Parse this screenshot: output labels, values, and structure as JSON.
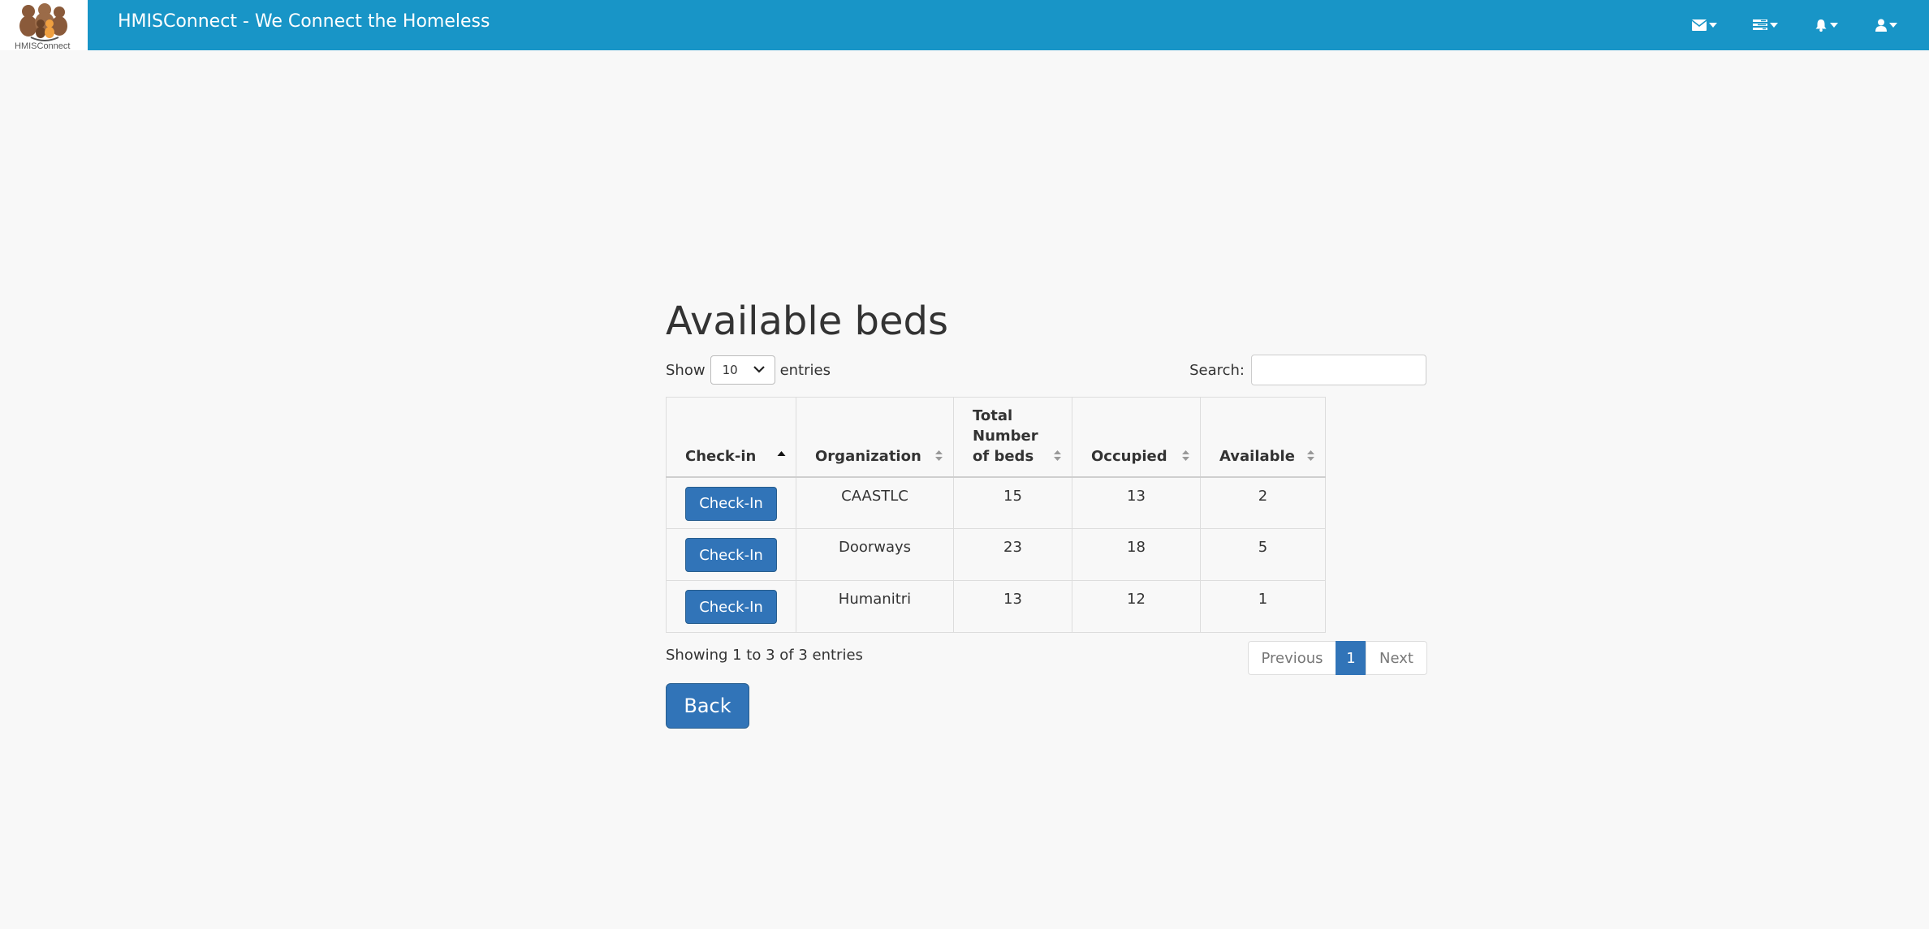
{
  "header": {
    "logo_text": "HMISConnect",
    "title": "HMISConnect - We Connect the Homeless",
    "icons": [
      "envelope-icon",
      "tasks-icon",
      "bell-icon",
      "user-icon"
    ],
    "bar_color": "#1895c7"
  },
  "page": {
    "title": "Available beds"
  },
  "length_menu": {
    "show_label": "Show",
    "selected": "10",
    "entries_label": "entries"
  },
  "search": {
    "label": "Search:",
    "value": ""
  },
  "table": {
    "columns": [
      "Check-in",
      "Organization",
      "Total Number of beds",
      "Occupied",
      "Available"
    ],
    "sorted_column": "Check-in",
    "rows": [
      {
        "action": "Check-In",
        "organization": "CAASTLC",
        "total": "15",
        "occupied": "13",
        "available": "2"
      },
      {
        "action": "Check-In",
        "organization": "Doorways",
        "total": "23",
        "occupied": "18",
        "available": "5"
      },
      {
        "action": "Check-In",
        "organization": "Humanitri",
        "total": "13",
        "occupied": "12",
        "available": "1"
      }
    ]
  },
  "info": "Showing 1 to 3 of 3 entries",
  "pagination": {
    "previous": "Previous",
    "current": "1",
    "next": "Next"
  },
  "back_label": "Back",
  "colors": {
    "primary_button": "#3174b8",
    "background": "#f8f8f8"
  }
}
